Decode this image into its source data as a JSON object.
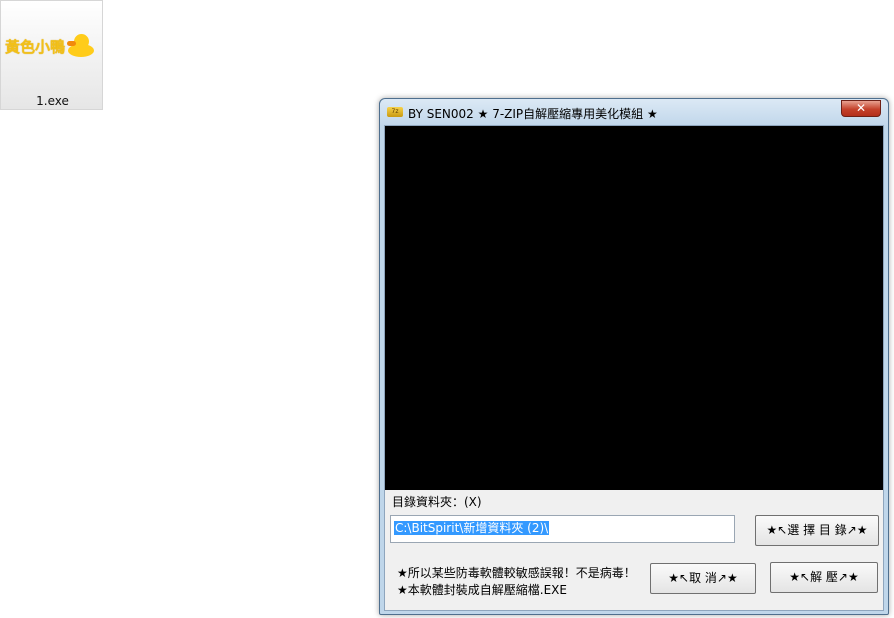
{
  "desktop": {
    "file": {
      "thumbnail_text": "黃色小鴨",
      "name": "1.exe",
      "icon": "duck-icon"
    }
  },
  "window": {
    "title": "BY SEN002 ★ 7-ZIP自解壓縮專用美化模組 ★",
    "app_icon_text": "7z",
    "close_label": "✕",
    "destination_label": "目錄資料夾：(X)",
    "destination_path": "C:\\BitSpirit\\新增資料夾 (2)\\",
    "browse_label": "★↖選 擇 目 錄↗★",
    "cancel_label": "★↖取 消↗★",
    "extract_label": "★↖解 壓↗★",
    "notes": [
      "★所以某些防毒軟體較敏感誤報！不是病毒！",
      "★本軟體封裝成自解壓縮檔.EXE"
    ],
    "colors": {
      "preview_background": "#000000",
      "selection": "#3399ff",
      "close_button": "#c4412b"
    }
  }
}
